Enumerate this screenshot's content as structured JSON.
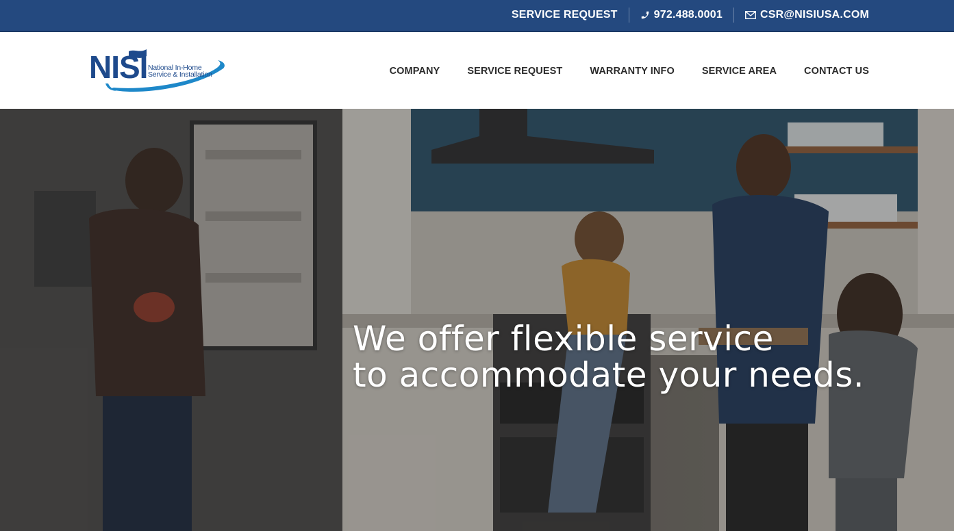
{
  "topbar": {
    "service_request": "SERVICE REQUEST",
    "phone": "972.488.0001",
    "email": "CSR@NISIUSA.COM",
    "phone_icon": "phone-icon",
    "email_icon": "envelope-icon",
    "background": "#24497f"
  },
  "logo": {
    "letters": "NISI",
    "line1": "National In-Home",
    "line2": "Service & Installation",
    "color": "#1e4a8c"
  },
  "nav": {
    "items": [
      {
        "label": "COMPANY"
      },
      {
        "label": "SERVICE REQUEST"
      },
      {
        "label": "WARRANTY INFO"
      },
      {
        "label": "SERVICE AREA"
      },
      {
        "label": "CONTACT US"
      }
    ]
  },
  "hero": {
    "line1": "We offer flexible service",
    "line2": "to accommodate your needs."
  }
}
